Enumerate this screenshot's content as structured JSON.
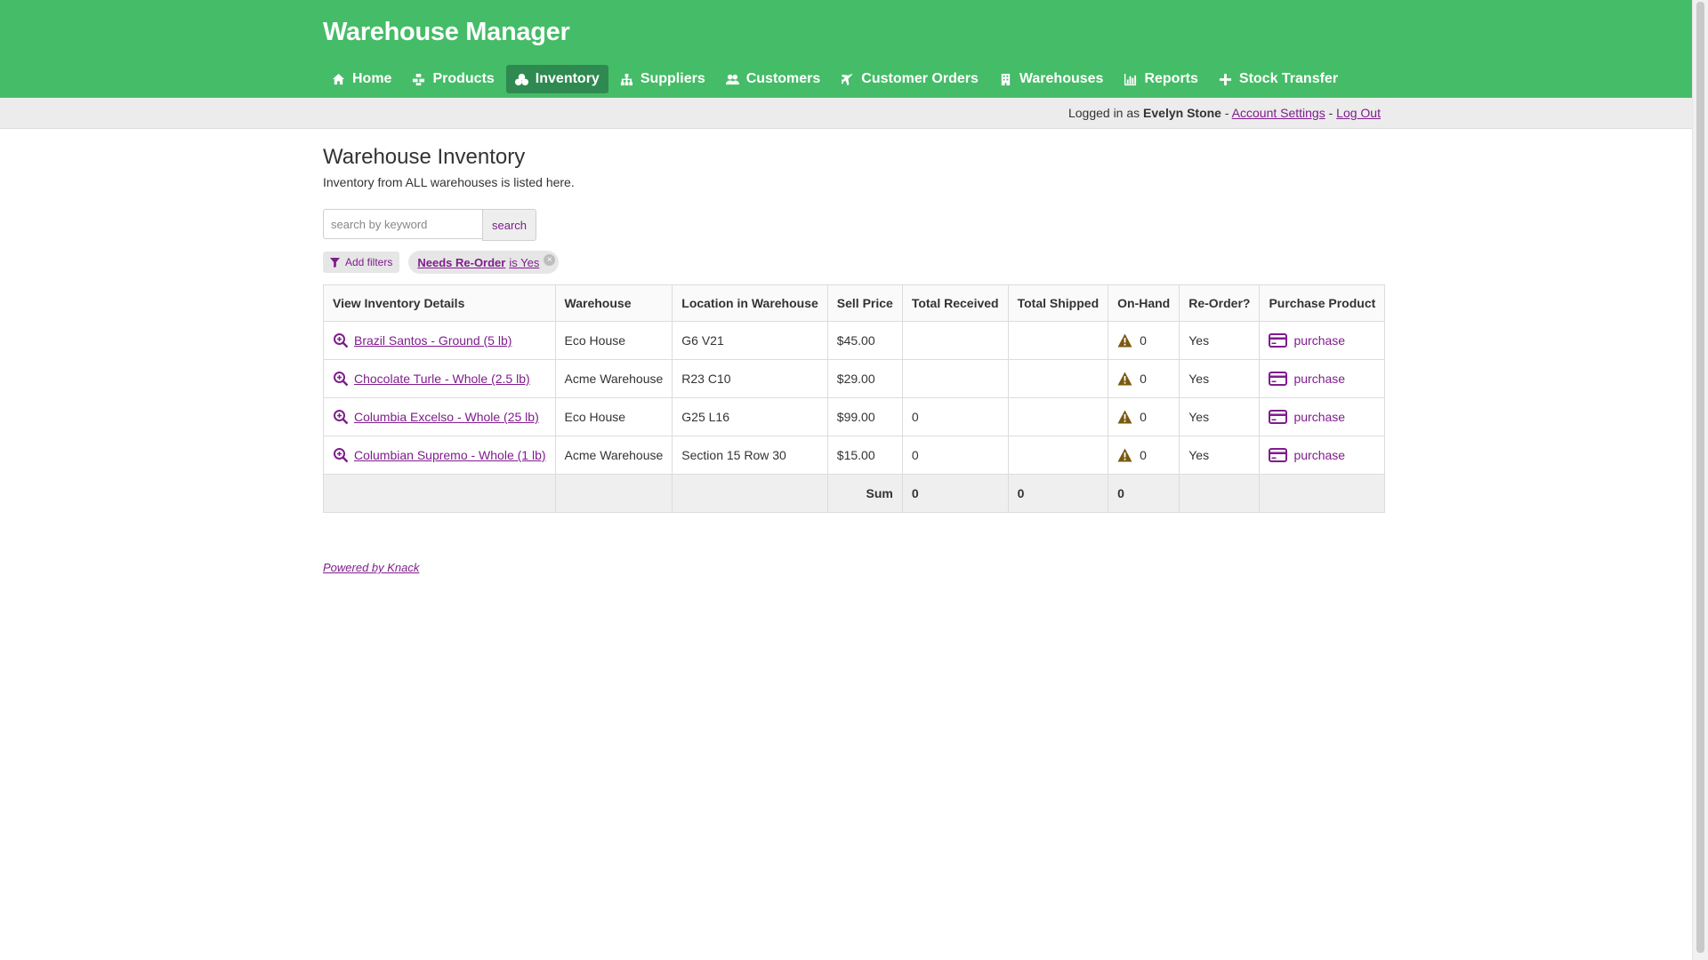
{
  "app": {
    "title": "Warehouse Manager"
  },
  "colors": {
    "header_bg": "#45bc67",
    "nav_active_bg": "#2e8a50",
    "link": "#7f1d8c",
    "warning_icon": "#7a5a12"
  },
  "nav": [
    {
      "label": "Home",
      "icon": "home-icon"
    },
    {
      "label": "Products",
      "icon": "cubes-icon"
    },
    {
      "label": "Inventory",
      "icon": "boxes-icon",
      "active": true
    },
    {
      "label": "Suppliers",
      "icon": "sitemap-icon"
    },
    {
      "label": "Customers",
      "icon": "users-icon"
    },
    {
      "label": "Customer Orders",
      "icon": "plane-icon"
    },
    {
      "label": "Warehouses",
      "icon": "building-icon"
    },
    {
      "label": "Reports",
      "icon": "bar-chart-icon"
    },
    {
      "label": "Stock Transfer",
      "icon": "plus-icon"
    }
  ],
  "userbar": {
    "logged_in_as": "Logged in as",
    "user_name": "Evelyn Stone",
    "separator": "-",
    "account_settings": "Account Settings",
    "log_out": "Log Out"
  },
  "page": {
    "title": "Warehouse Inventory",
    "description": "Inventory from ALL warehouses is listed here."
  },
  "search": {
    "placeholder": "search by keyword",
    "value": "",
    "button": "search"
  },
  "filters": {
    "add_label": "Add filters",
    "active": {
      "field": "Needs Re-Order",
      "operator": "is Yes",
      "close": "×"
    }
  },
  "table": {
    "columns": [
      "View Inventory Details",
      "Warehouse",
      "Location in Warehouse",
      "Sell Price",
      "Total Received",
      "Total Shipped",
      "On-Hand",
      "Re-Order?",
      "Purchase Product"
    ],
    "rows": [
      {
        "name": "Brazil Santos - Ground (5 lb)",
        "warehouse": "Eco House",
        "location": "G6 V21",
        "price": "$45.00",
        "received": "",
        "shipped": "",
        "on_hand": "0",
        "reorder": "Yes",
        "purchase": "purchase"
      },
      {
        "name": "Chocolate Turle - Whole (2.5 lb)",
        "warehouse": "Acme Warehouse",
        "location": "R23 C10",
        "price": "$29.00",
        "received": "",
        "shipped": "",
        "on_hand": "0",
        "reorder": "Yes",
        "purchase": "purchase"
      },
      {
        "name": "Columbia Excelso - Whole (25 lb)",
        "warehouse": "Eco House",
        "location": "G25 L16",
        "price": "$99.00",
        "received": "0",
        "shipped": "",
        "on_hand": "0",
        "reorder": "Yes",
        "purchase": "purchase"
      },
      {
        "name": "Columbian Supremo - Whole (1 lb)",
        "warehouse": "Acme Warehouse",
        "location": "Section 15 Row 30",
        "price": "$15.00",
        "received": "0",
        "shipped": "",
        "on_hand": "0",
        "reorder": "Yes",
        "purchase": "purchase"
      }
    ],
    "summary": {
      "label": "Sum",
      "received": "0",
      "shipped": "0",
      "on_hand": "0"
    }
  },
  "footer": {
    "powered_by": "Powered by Knack"
  }
}
